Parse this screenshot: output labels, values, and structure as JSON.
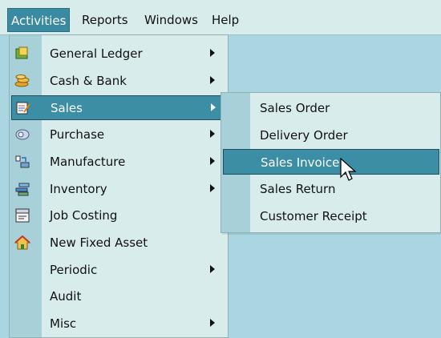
{
  "menubar": {
    "items": [
      {
        "label": "Activities",
        "active": true
      },
      {
        "label": "Reports",
        "active": false
      },
      {
        "label": "Windows",
        "active": false
      },
      {
        "label": "Help",
        "active": false
      }
    ]
  },
  "activities_menu": {
    "items": [
      {
        "label": "General Ledger",
        "icon": "general-ledger-icon",
        "has_submenu": true
      },
      {
        "label": "Cash & Bank",
        "icon": "cash-bank-icon",
        "has_submenu": true
      },
      {
        "label": "Sales",
        "icon": "sales-icon",
        "has_submenu": true,
        "highlighted": true
      },
      {
        "label": "Purchase",
        "icon": "purchase-icon",
        "has_submenu": true
      },
      {
        "label": "Manufacture",
        "icon": "manufacture-icon",
        "has_submenu": true
      },
      {
        "label": "Inventory",
        "icon": "inventory-icon",
        "has_submenu": true
      },
      {
        "label": "Job Costing",
        "icon": "job-costing-icon",
        "has_submenu": false
      },
      {
        "label": "New Fixed Asset",
        "icon": "fixed-asset-icon",
        "has_submenu": false
      },
      {
        "label": "Periodic",
        "icon": "",
        "has_submenu": true
      },
      {
        "label": "Audit",
        "icon": "",
        "has_submenu": false
      },
      {
        "label": "Misc",
        "icon": "",
        "has_submenu": true
      }
    ]
  },
  "sales_submenu": {
    "items": [
      {
        "label": "Sales Order",
        "highlighted": false
      },
      {
        "label": "Delivery Order",
        "highlighted": false
      },
      {
        "label": "Sales Invoice",
        "highlighted": true
      },
      {
        "label": "Sales Return",
        "highlighted": false
      },
      {
        "label": "Customer Receipt",
        "highlighted": false
      }
    ]
  },
  "colors": {
    "highlight": "#3b8ea4",
    "menu_bg": "#d8ecec",
    "gutter": "#a7d0d8",
    "desktop": "#a9d6e0"
  }
}
